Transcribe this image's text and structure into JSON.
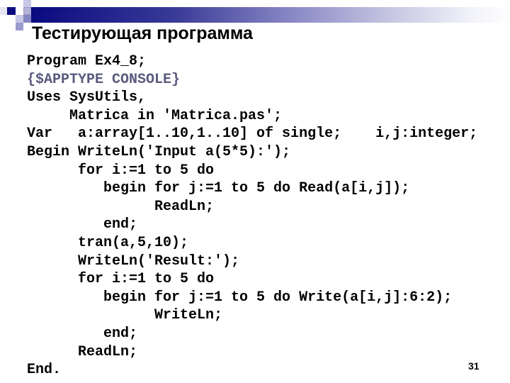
{
  "slide": {
    "title": "Тестирующая программа",
    "page_number": "31",
    "colors": {
      "accent_dark": "#0c0c80",
      "comment": "#5a5a7e",
      "text": "#000000"
    },
    "code_lines": [
      {
        "text": "Program Ex4_8;",
        "kind": "code"
      },
      {
        "text": "{$APPTYPE CONSOLE}",
        "kind": "comment"
      },
      {
        "text": "Uses SysUtils,",
        "kind": "code"
      },
      {
        "text": "     Matrica in 'Matrica.pas';",
        "kind": "code"
      },
      {
        "text": "Var   a:array[1..10,1..10] of single;    i,j:integer;",
        "kind": "code"
      },
      {
        "text": "Begin WriteLn('Input a(5*5):');",
        "kind": "code"
      },
      {
        "text": "      for i:=1 to 5 do",
        "kind": "code"
      },
      {
        "text": "         begin for j:=1 to 5 do Read(a[i,j]);",
        "kind": "code"
      },
      {
        "text": "               ReadLn;",
        "kind": "code"
      },
      {
        "text": "         end;",
        "kind": "code"
      },
      {
        "text": "      tran(a,5,10);",
        "kind": "code"
      },
      {
        "text": "      WriteLn('Result:');",
        "kind": "code"
      },
      {
        "text": "      for i:=1 to 5 do",
        "kind": "code"
      },
      {
        "text": "         begin for j:=1 to 5 do Write(a[i,j]:6:2);",
        "kind": "code"
      },
      {
        "text": "               WriteLn;",
        "kind": "code"
      },
      {
        "text": "         end;",
        "kind": "code"
      },
      {
        "text": "      ReadLn;",
        "kind": "code"
      },
      {
        "text": "End.",
        "kind": "code"
      }
    ]
  }
}
